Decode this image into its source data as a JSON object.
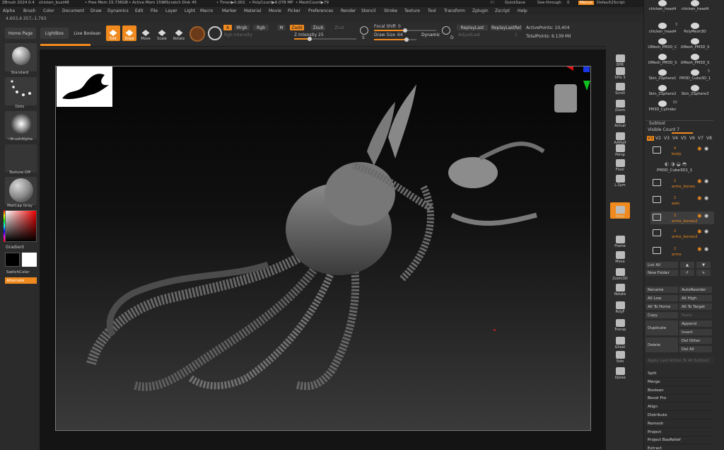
{
  "titlebar": {
    "app": "ZBrush 2024.0.4",
    "file": "chicken_bust48",
    "free_mem": "• Free Mem 15.736GB",
    "active_mem": "• Active Mem 1593",
    "scratch": "• Scratch Disk 45",
    "timer": "• Timer▶0.001",
    "polycount": "• PolyCount▶6.078 MP",
    "meshcount": "• MeshCount▶79",
    "ac": "AC",
    "quicksave": "QuickSave",
    "seethrough": "See-through",
    "seethrough_val": "0",
    "menus": "Menus",
    "script": "Default2Script"
  },
  "menubar": [
    "Alpha",
    "Brush",
    "Color",
    "Document",
    "Draw",
    "Dynamics",
    "Edit",
    "File",
    "Layer",
    "Light",
    "Macro",
    "Marker",
    "Material",
    "Movie",
    "Picker",
    "Preferences",
    "Render",
    "Stencil",
    "Stroke",
    "Texture",
    "Tool",
    "Transform",
    "Zplugin",
    "Zscript",
    "Help"
  ],
  "coords": "4.603,4.357,-1.793",
  "shelf": {
    "home": "Home Page",
    "lightbox": "LightBox",
    "liveboolean": "Live Boolean",
    "edit": "Edit",
    "draw": "Draw",
    "move": "Move",
    "scale": "Scale",
    "rotate": "Rotate",
    "a": "A",
    "mrgb": "Mrgb",
    "rgb": "Rgb",
    "m": "M",
    "rgb_intensity": "Rgb Intensity",
    "zadd": "Zadd",
    "zsub": "Zsub",
    "zcut": "Zcut",
    "z_intensity": "Z Intensity",
    "z_intensity_val": "25",
    "z_intensity_level": 0.25,
    "s": "S",
    "focal_shift": "Focal Shift",
    "focal_shift_val": "0",
    "draw_size": "Draw Size",
    "draw_size_val": "64",
    "dynamic": "Dynamic",
    "d": "D",
    "replay_last": "ReplayLast",
    "replay_last_rel": "ReplayLastRel",
    "adjust_last": "AdjustLast",
    "adjust_last_val": "1",
    "active_points": "ActivePoints: 10,404",
    "total_points": "TotalPoints: 6.139 Mil"
  },
  "lefttray": {
    "standard": "Standard",
    "dots": "Dots",
    "brushalpha": "~BrushAlpha",
    "textureoff": "Texture Off",
    "matcap": "MatCap Gray",
    "gradient": "Gradient",
    "switchcolor": "SwitchColor",
    "alternate": "Alternate"
  },
  "righttray": [
    "BPR",
    "SPix 3",
    "Scroll",
    "Zoom",
    "Actual",
    "AAHalf",
    "Persp",
    "Floor",
    "L.Sym",
    "Qxyz",
    "Frame",
    "Move",
    "Zoom3D",
    "Rotate",
    "PolyF",
    "Transp",
    "Ghost",
    "Solo",
    "Xpose"
  ],
  "colors": {
    "accent": "#f08a1e",
    "panel": "#2b2b2b",
    "canvas": "#141414"
  },
  "toolpanel": {
    "tools": [
      {
        "name": "chicken_head4",
        "badge": ""
      },
      {
        "name": "chicken_head4",
        "badge": ""
      },
      {
        "name": "chicken_head4",
        "badge": "3"
      },
      {
        "name": "PolyMesh3D",
        "badge": ""
      },
      {
        "name": "UMesh_PM3D_C",
        "badge": ""
      },
      {
        "name": "UMesh_PM3D_S",
        "badge": ""
      },
      {
        "name": "UMesh_PM3D_S",
        "badge": ""
      },
      {
        "name": "UMesh_PM3D_S",
        "badge": ""
      },
      {
        "name": "Skin_ZSphere1",
        "badge": ""
      },
      {
        "name": "PM3D_Cube3D_1",
        "badge": "5"
      },
      {
        "name": "Skin_ZSphere2",
        "badge": ""
      },
      {
        "name": "Skin_ZSphere3",
        "badge": ""
      },
      {
        "name": "PM3D_Cylinder",
        "badge": "92"
      }
    ]
  },
  "subtool": {
    "title": "Subtool",
    "visible_count": "Visible Count 7",
    "versions": [
      "V1",
      "V2",
      "V3",
      "V4",
      "V5",
      "V6",
      "V7",
      "V8"
    ],
    "rows": [
      {
        "name": "body",
        "count": "4"
      },
      {
        "name": "PM3D_Cube3D1_1",
        "count": ""
      },
      {
        "name": "arms_bones",
        "count": "2"
      },
      {
        "name": "eels",
        "count": "2"
      },
      {
        "name": "arms_bones2",
        "count": "3"
      },
      {
        "name": "arms_bones2",
        "count": "2"
      },
      {
        "name": "arms",
        "count": "2"
      }
    ],
    "list_all": "List All",
    "new_folder": "New Folder",
    "rename": "Rename",
    "autoreorder": "AutoReorder",
    "all_low": "All Low",
    "all_high": "All High",
    "all_to_home": "All To Home",
    "all_to_target": "All To Target",
    "copy": "Copy",
    "paste": "Paste",
    "duplicate": "Duplicate",
    "append": "Append",
    "insert": "Insert",
    "delete": "Delete",
    "del_other": "Del Other",
    "del_all": "Del All",
    "apply_last": "Apply Last Action To All Subtool",
    "sections": [
      "Split",
      "Merge",
      "Boolean",
      "Bevel Pro",
      "Align",
      "Distribute",
      "Remesh",
      "Project",
      "Project BasRelief",
      "Extract"
    ]
  }
}
